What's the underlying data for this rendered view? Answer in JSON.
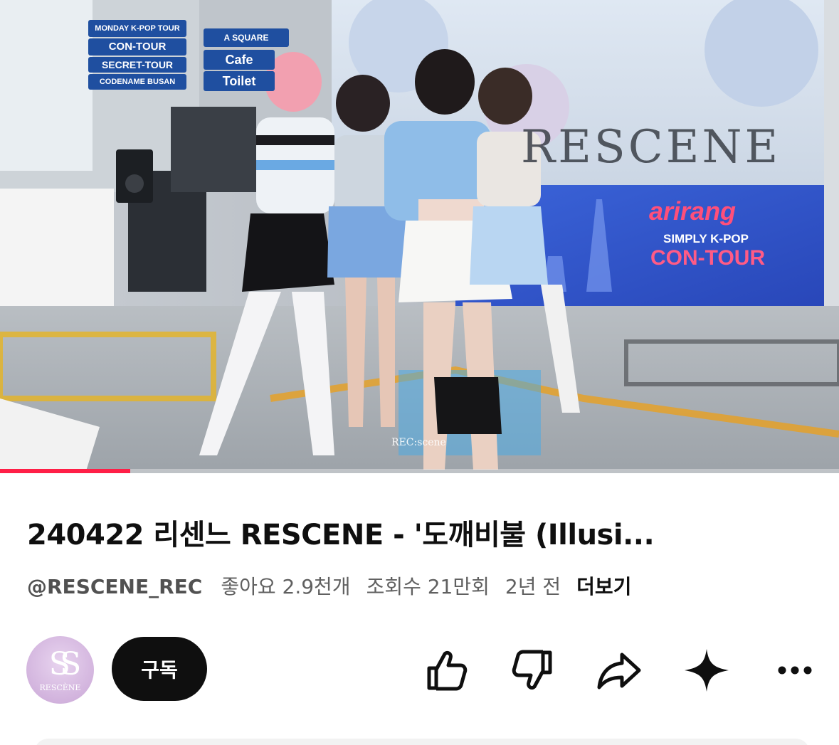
{
  "video": {
    "watermark": "REC:scene",
    "progress_fraction": 0.155,
    "progress_color": "#ff1f47",
    "signs": {
      "monday": "MONDAY K-POP TOUR",
      "con_tour": "CON-TOUR",
      "secret_tour": "SECRET-TOUR",
      "codename": "CODENAME BUSAN",
      "a_square": "A SQUARE",
      "cafe": "Cafe",
      "toilet": "Toilet"
    },
    "banner": {
      "brand": "arirang",
      "simply": "SIMPLY K-POP",
      "con_tour": "CON-TOUR",
      "group": "RESCENE"
    }
  },
  "info": {
    "title": "240422 리센느 RESCENE - '도깨비불 (Illusi...",
    "channel_handle": "@RESCENE_REC",
    "likes": "좋아요 2.9천개",
    "views": "조회수 21만회",
    "age": "2년 전",
    "more": "더보기"
  },
  "channel": {
    "avatar_logo": "SS",
    "avatar_name": "RESCÈNE",
    "subscribe_label": "구독"
  },
  "actions": {
    "like_icon": "thumbs-up-icon",
    "dislike_icon": "thumbs-down-icon",
    "share_icon": "share-icon",
    "ai_icon": "sparkle-icon",
    "more_icon": "more-horizontal-icon"
  }
}
